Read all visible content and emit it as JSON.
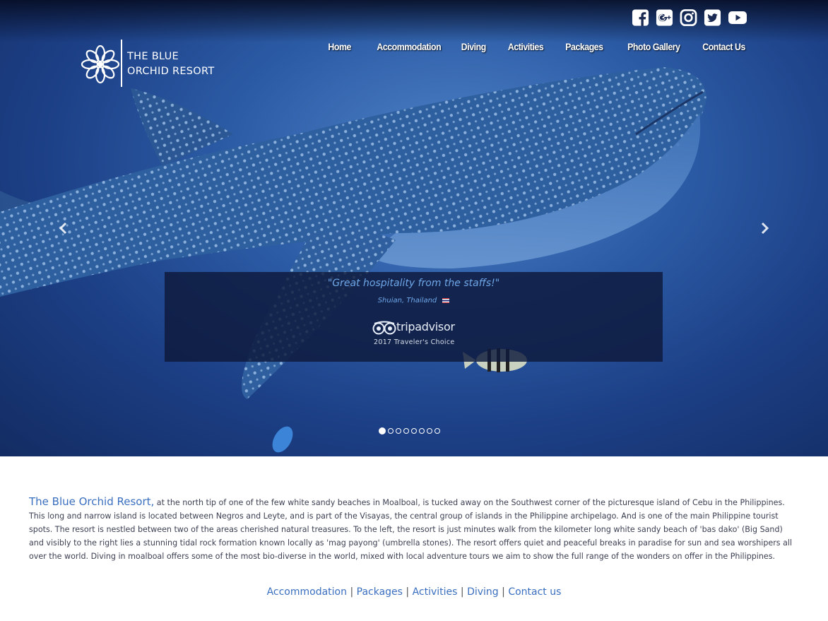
{
  "logo": {
    "line1": "THE BLUE",
    "line2": "ORCHID RESORT"
  },
  "social": [
    "facebook-icon",
    "google-plus-icon",
    "instagram-icon",
    "twitter-icon",
    "youtube-icon"
  ],
  "nav": [
    "Home",
    "Accommodation",
    "Diving",
    "Activities",
    "Packages",
    "Photo Gallery",
    "Contact Us"
  ],
  "slider": {
    "quote": "\"Great hospitality from the staffs!\"",
    "author": "Shuian, Thailand",
    "award_brand": "tripadvisor",
    "award_sub": "2017 Traveler's Choice",
    "slide_count": 8,
    "active_slide": 1
  },
  "intro": {
    "lead": "The Blue Orchid Resort,",
    "text": " at the north tip of one of the few white sandy beaches in Moalboal, is tucked away on the Southwest corner of the picturesque island of Cebu in the Philippines. This long and narrow island is located between Negros and Leyte, and is part of the Visayas, the central group of islands in the Philippine archipelago. And is one of the main Philippine tourist spots. The resort is nestled between two of the areas cherished natural treasures. To the left, the resort is just minutes walk from the kilometer long white sandy beach of 'bas dako' (Big Sand) and visibly to the right lies a stunning tidal rock formation known locally as 'mag payong' (umbrella stones). The resort offers quiet and peaceful breaks in paradise for sun and sea worshipers all over the world. Diving in moalboal offers some of the most bio-diverse in the world, mixed with local adventure tours we aim to show the full range of the wonders on offer in the Philippines."
  },
  "footer_links": [
    "Accommodation",
    "Packages",
    "Activities",
    "Diving",
    "Contact us"
  ],
  "colors": {
    "link": "#3a6fbf",
    "water": "#2c5ca6",
    "quote": "#6ea6e8"
  }
}
